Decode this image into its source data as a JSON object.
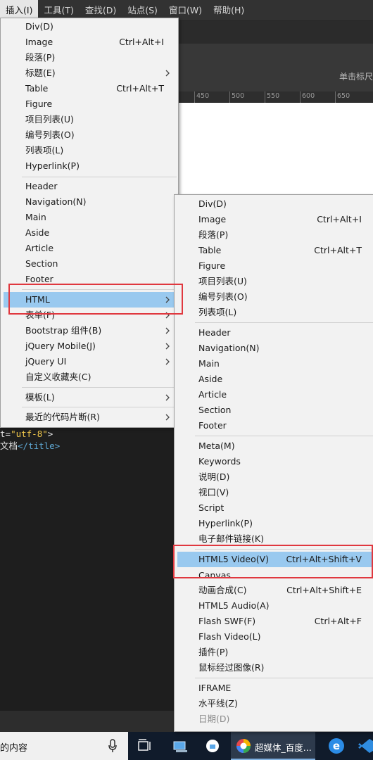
{
  "menubar": [
    {
      "label": "插入(I)"
    },
    {
      "label": "工具(T)"
    },
    {
      "label": "查找(D)"
    },
    {
      "label": "站点(S)"
    },
    {
      "label": "窗口(W)"
    },
    {
      "label": "帮助(H)"
    }
  ],
  "editor": {
    "hint": "单击标尺",
    "ruler_ticks": [
      "450",
      "500",
      "550",
      "600",
      "650"
    ],
    "code": {
      "line1_prefix": "t=",
      "line1_string": "\"utf-8\"",
      "line1_suffix": ">",
      "line2_text": "文档",
      "line2_tag": "</title>"
    }
  },
  "insert_menu": {
    "items": [
      {
        "label": "Div(D)",
        "shortcut": ""
      },
      {
        "label": "Image",
        "shortcut": "Ctrl+Alt+I"
      },
      {
        "label": "段落(P)",
        "shortcut": ""
      },
      {
        "label": "标题(E)",
        "shortcut": "",
        "submenu": true
      },
      {
        "label": "Table",
        "shortcut": "Ctrl+Alt+T"
      },
      {
        "label": "Figure",
        "shortcut": ""
      },
      {
        "label": "项目列表(U)",
        "shortcut": ""
      },
      {
        "label": "编号列表(O)",
        "shortcut": ""
      },
      {
        "label": "列表项(L)",
        "shortcut": ""
      },
      {
        "label": "Hyperlink(P)",
        "shortcut": ""
      },
      {
        "label": "Header",
        "shortcut": ""
      },
      {
        "label": "Navigation(N)",
        "shortcut": ""
      },
      {
        "label": "Main",
        "shortcut": ""
      },
      {
        "label": "Aside",
        "shortcut": ""
      },
      {
        "label": "Article",
        "shortcut": ""
      },
      {
        "label": "Section",
        "shortcut": ""
      },
      {
        "label": "Footer",
        "shortcut": ""
      },
      {
        "label": "HTML",
        "shortcut": "",
        "submenu": true,
        "highlighted": true
      },
      {
        "label": "表单(F)",
        "shortcut": "",
        "submenu": true
      },
      {
        "label": "Bootstrap 组件(B)",
        "shortcut": "",
        "submenu": true
      },
      {
        "label": "jQuery Mobile(J)",
        "shortcut": "",
        "submenu": true
      },
      {
        "label": "jQuery UI",
        "shortcut": "",
        "submenu": true
      },
      {
        "label": "自定义收藏夹(C)",
        "shortcut": ""
      },
      {
        "label": "模板(L)",
        "shortcut": "",
        "submenu": true
      },
      {
        "label": "最近的代码片断(R)",
        "shortcut": "",
        "submenu": true
      }
    ]
  },
  "html_submenu": {
    "items": [
      {
        "label": "Div(D)",
        "shortcut": ""
      },
      {
        "label": "Image",
        "shortcut": "Ctrl+Alt+I"
      },
      {
        "label": "段落(P)",
        "shortcut": ""
      },
      {
        "label": "Table",
        "shortcut": "Ctrl+Alt+T"
      },
      {
        "label": "Figure",
        "shortcut": ""
      },
      {
        "label": "项目列表(U)",
        "shortcut": ""
      },
      {
        "label": "编号列表(O)",
        "shortcut": ""
      },
      {
        "label": "列表项(L)",
        "shortcut": ""
      },
      {
        "label": "Header",
        "shortcut": ""
      },
      {
        "label": "Navigation(N)",
        "shortcut": ""
      },
      {
        "label": "Main",
        "shortcut": ""
      },
      {
        "label": "Aside",
        "shortcut": ""
      },
      {
        "label": "Article",
        "shortcut": ""
      },
      {
        "label": "Section",
        "shortcut": ""
      },
      {
        "label": "Footer",
        "shortcut": ""
      },
      {
        "label": "Meta(M)",
        "shortcut": ""
      },
      {
        "label": "Keywords",
        "shortcut": ""
      },
      {
        "label": "说明(D)",
        "shortcut": ""
      },
      {
        "label": "视口(V)",
        "shortcut": ""
      },
      {
        "label": "Script",
        "shortcut": ""
      },
      {
        "label": "Hyperlink(P)",
        "shortcut": ""
      },
      {
        "label": "电子邮件链接(K)",
        "shortcut": ""
      },
      {
        "label": "HTML5 Video(V)",
        "shortcut": "Ctrl+Alt+Shift+V",
        "highlighted": true
      },
      {
        "label": "Canvas",
        "shortcut": ""
      },
      {
        "label": "动画合成(C)",
        "shortcut": "Ctrl+Alt+Shift+E"
      },
      {
        "label": "HTML5 Audio(A)",
        "shortcut": ""
      },
      {
        "label": "Flash SWF(F)",
        "shortcut": "Ctrl+Alt+F"
      },
      {
        "label": "Flash Video(L)",
        "shortcut": ""
      },
      {
        "label": "插件(P)",
        "shortcut": ""
      },
      {
        "label": "鼠标经过图像(R)",
        "shortcut": ""
      },
      {
        "label": "IFRAME",
        "shortcut": ""
      },
      {
        "label": "水平线(Z)",
        "shortcut": ""
      },
      {
        "label": "日期(D)",
        "shortcut": "",
        "disabled": true
      }
    ]
  },
  "taskbar": {
    "search_text": "的内容",
    "active_app_label": "超媒体_百度..."
  },
  "colors": {
    "highlight": "#99c9ef",
    "annotation_box": "#e0383f"
  },
  "icons": [
    "microphone-icon",
    "task-view-icon",
    "computer-icon",
    "browser-app-icon",
    "edge-browser-icon",
    "vscode-icon",
    "chevron-right-icon"
  ]
}
